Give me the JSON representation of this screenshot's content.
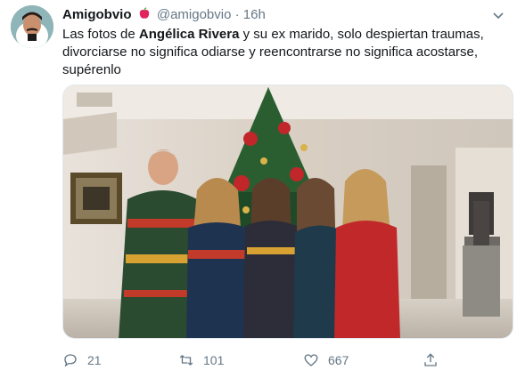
{
  "tweet": {
    "author_name": "Amigobvio",
    "author_handle": "@amigobvio",
    "separator": "·",
    "time": "16h",
    "text_part1": "Las fotos de ",
    "text_bold": "Angélica Rivera",
    "text_part2": " y su ex marido, solo despiertan traumas, divorciarse no significa odiarse y reencontrarse no significa acostarse, supérenlo"
  },
  "actions": {
    "replies": "21",
    "retweets": "101",
    "likes": "667"
  },
  "colors": {
    "text": "#14171a",
    "muted": "#657786",
    "apple": "#e0245e"
  },
  "icons": [
    "apple-emoji-icon",
    "caret-down-icon",
    "reply-icon",
    "retweet-icon",
    "like-icon",
    "share-icon"
  ]
}
